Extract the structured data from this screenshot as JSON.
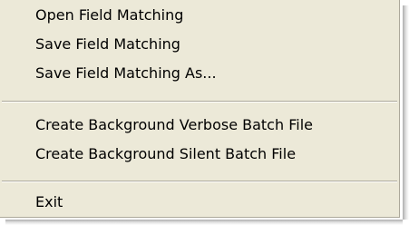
{
  "menu": {
    "groups": [
      {
        "items": [
          {
            "label": "Open Field Matching"
          },
          {
            "label": "Save Field Matching"
          },
          {
            "label": "Save Field Matching As..."
          }
        ]
      },
      {
        "items": [
          {
            "label": "Create Background Verbose Batch File"
          },
          {
            "label": "Create Background Silent Batch File"
          }
        ]
      },
      {
        "items": [
          {
            "label": "Exit"
          }
        ]
      }
    ]
  }
}
